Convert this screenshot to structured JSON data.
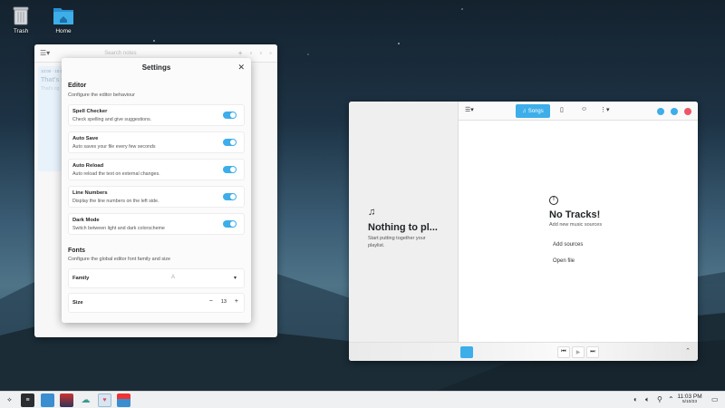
{
  "desktop": {
    "icons": [
      {
        "label": "Trash",
        "icon": "trash-icon"
      },
      {
        "label": "Home",
        "icon": "home-folder-icon"
      }
    ]
  },
  "editor": {
    "search_placeholder": "Search notes",
    "note": {
      "date": "10:00 · 10 Oct",
      "title": "That's n",
      "body": "That's rig"
    }
  },
  "settings": {
    "title": "Settings",
    "editor_section": {
      "title": "Editor",
      "subtitle": "Configure the editor behaviour",
      "options": [
        {
          "title": "Spell Checker",
          "desc": "Check spelling and give suggestions.",
          "on": true
        },
        {
          "title": "Auto Save",
          "desc": "Auto saves your file every few seconds",
          "on": true
        },
        {
          "title": "Auto Reload",
          "desc": "Auto reload the text on external changes.",
          "on": true
        },
        {
          "title": "Line Numbers",
          "desc": "Display the line numbers on the left side.",
          "on": true
        },
        {
          "title": "Dark Mode",
          "desc": "Switch between light and dark colorscheme",
          "on": true
        }
      ]
    },
    "fonts_section": {
      "title": "Fonts",
      "subtitle": "Configure the global editor font family and size",
      "family_label": "Family",
      "family_value": "A",
      "size_label": "Size",
      "size_value": "13",
      "minus": "−",
      "plus": "+"
    }
  },
  "music": {
    "toolbar": {
      "songs_label": "Songs"
    },
    "playlist_empty": {
      "title": "Nothing to pl...",
      "subtitle": "Start putting together your playlist."
    },
    "tracks_empty": {
      "title": "No Tracks!",
      "subtitle": "Add new music sources"
    },
    "actions": {
      "add_sources": "Add sources",
      "open_file": "Open file"
    }
  },
  "taskbar": {
    "time": "11:03 PM",
    "date": "5/10/23"
  },
  "colors": {
    "accent": "#3daee9",
    "close": "#ed5565"
  }
}
